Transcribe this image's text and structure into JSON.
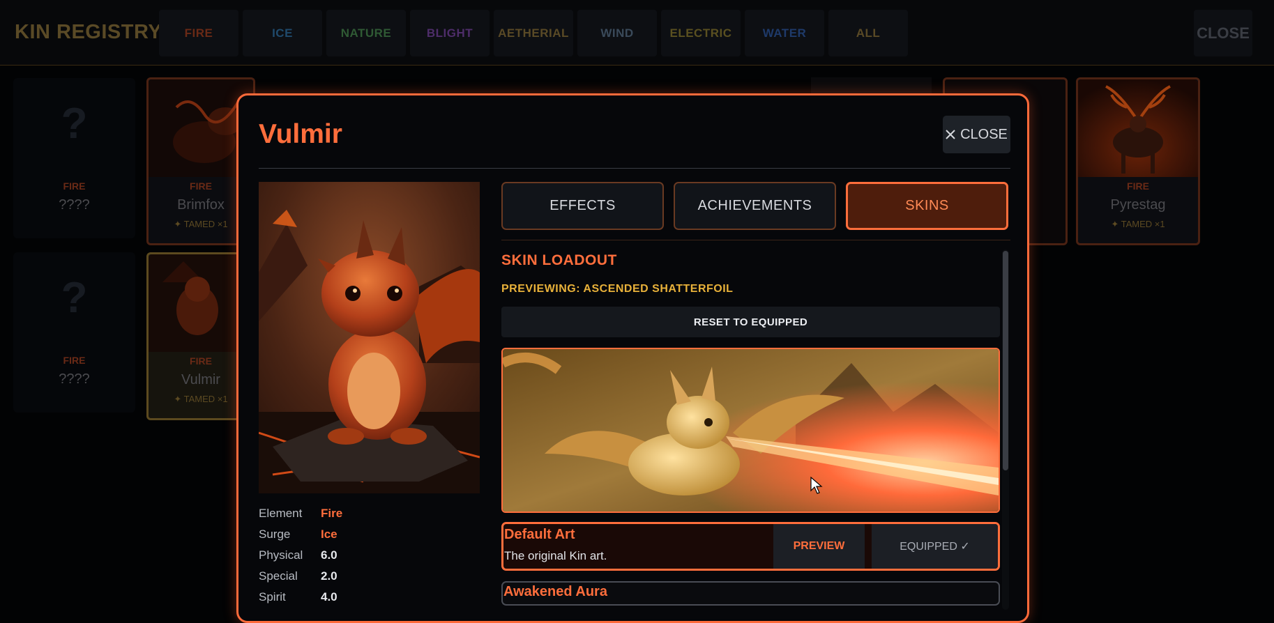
{
  "registry": {
    "title": "KIN REGISTRY",
    "tabs": [
      {
        "label": "FIRE",
        "color": "#6a2a16"
      },
      {
        "label": "ICE",
        "color": "#1f4a6c"
      },
      {
        "label": "NATURE",
        "color": "#2f5a34"
      },
      {
        "label": "BLIGHT",
        "color": "#4e2d6a"
      },
      {
        "label": "AETHERIAL",
        "color": "#5a4a26"
      },
      {
        "label": "WIND",
        "color": "#3a4a5a"
      },
      {
        "label": "ELECTRIC",
        "color": "#5a5020"
      },
      {
        "label": "WATER",
        "color": "#1e3a6a"
      },
      {
        "label": "ALL",
        "color": "#5a4a26"
      }
    ],
    "close_label": "CLOSE",
    "cards": [
      {
        "element": "FIRE",
        "name": "????"
      },
      {
        "element": "FIRE",
        "name": "Brimfox",
        "tamed": "✦ TAMED ×1"
      },
      {
        "element": "FIRE",
        "name": "Pyrestag",
        "tamed": "✦ TAMED ×1"
      },
      {
        "element": "FIRE",
        "name": "????"
      },
      {
        "element": "FIRE",
        "name": "Vulmir",
        "tamed": "✦ TAMED ×1"
      }
    ]
  },
  "modal": {
    "title": "Vulmir",
    "close_label": "CLOSE",
    "tabs": [
      "EFFECTS",
      "ACHIEVEMENTS",
      "SKINS"
    ],
    "active_tab": "SKINS",
    "stats": [
      {
        "label": "Element",
        "value": "Fire"
      },
      {
        "label": "Surge",
        "value": "Ice"
      },
      {
        "label": "Physical",
        "value": "6.0"
      },
      {
        "label": "Special",
        "value": "2.0"
      },
      {
        "label": "Spirit",
        "value": "4.0"
      }
    ],
    "skins_panel": {
      "title": "SKIN LOADOUT",
      "previewing": "PREVIEWING: ASCENDED SHATTERFOIL",
      "reset_label": "RESET TO EQUIPPED",
      "skins": [
        {
          "name": "Default Art",
          "description": "The original Kin art.",
          "preview_label": "PREVIEW",
          "status_label": "EQUIPPED ✓"
        },
        {
          "name": "Awakened Aura"
        }
      ]
    }
  },
  "colors": {
    "accent": "#ff6e3c",
    "gold": "#e8b13a"
  }
}
